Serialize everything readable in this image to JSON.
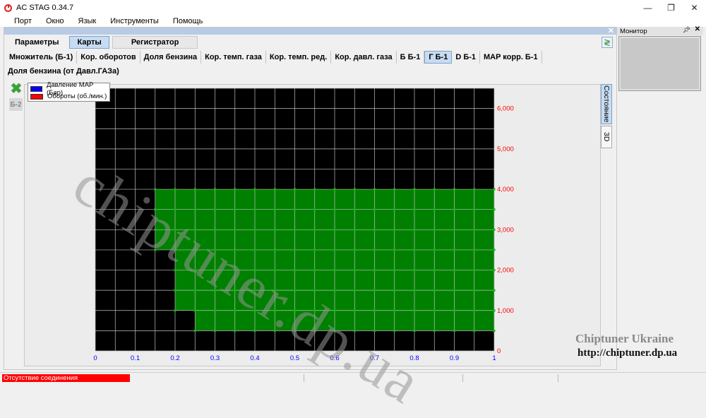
{
  "window": {
    "title": "AC STAG 0.34.7",
    "controls": [
      "—",
      "❐",
      "✕"
    ]
  },
  "menu": [
    "Порт",
    "Окно",
    "Язык",
    "Инструменты",
    "Помощь"
  ],
  "main_tabs": [
    {
      "label": "Параметры",
      "active": false
    },
    {
      "label": "Карты",
      "active": true
    },
    {
      "label": "Регистратор",
      "active": false
    }
  ],
  "map_tabs": [
    {
      "label": "Множитель (Б-1)",
      "active": false
    },
    {
      "label": "Кор. оборотов",
      "active": false
    },
    {
      "label": "Доля бензина",
      "active": false
    },
    {
      "label": "Кор. темп. газа",
      "active": false
    },
    {
      "label": "Кор. темп. ред.",
      "active": false
    },
    {
      "label": "Кор. давл. газа",
      "active": false
    },
    {
      "label": "Б Б-1",
      "active": false
    },
    {
      "label": "Г Б-1",
      "active": true
    },
    {
      "label": "D Б-1",
      "active": false
    },
    {
      "label": "MAP корр. Б-1",
      "active": false
    }
  ],
  "map_title": "Доля бензина (от Давл.ГАЗа)",
  "bank_button": "Б-2",
  "legend": [
    {
      "label": "Давление MAP (Бар)",
      "color": "#0000ff"
    },
    {
      "label": "Обороты (об./мин.)",
      "color": "#ff0000"
    }
  ],
  "side_tabs": [
    {
      "label": "Состояние",
      "active": true
    },
    {
      "label": "3D",
      "active": false
    }
  ],
  "monitor": {
    "title": "Монитор"
  },
  "status": {
    "connection": "Отсутствие соединения",
    "color": "#ff0000"
  },
  "watermark": {
    "big": "chiptuner.dp.ua",
    "brand": "Chiptuner Ukraine",
    "url": "http://chiptuner.dp.ua"
  },
  "chart_data": {
    "type": "heatmap",
    "x_ticks": [
      "0",
      "0.1",
      "0.2",
      "0.3",
      "0.4",
      "0.5",
      "0.6",
      "0.7",
      "0.8",
      "0.9",
      "1"
    ],
    "y_ticks": [
      "0",
      "1,000",
      "2,000",
      "3,000",
      "4,000",
      "5,000",
      "6,000"
    ],
    "xlim": [
      0,
      1
    ],
    "ylim": [
      0,
      6500
    ],
    "x_tick_color": "#0000ff",
    "y_tick_color": "#ff0000",
    "background": "#000000",
    "fill_color": "#008000",
    "grid": true,
    "grid_step_x": 0.05,
    "grid_step_y": 500,
    "filled_region": [
      {
        "x_from": 0.15,
        "x_to": 1.0,
        "y_from": 2500,
        "y_to": 4000
      },
      {
        "x_from": 0.2,
        "x_to": 1.0,
        "y_from": 1000,
        "y_to": 2500
      },
      {
        "x_from": 0.25,
        "x_to": 1.0,
        "y_from": 500,
        "y_to": 1000
      }
    ]
  }
}
